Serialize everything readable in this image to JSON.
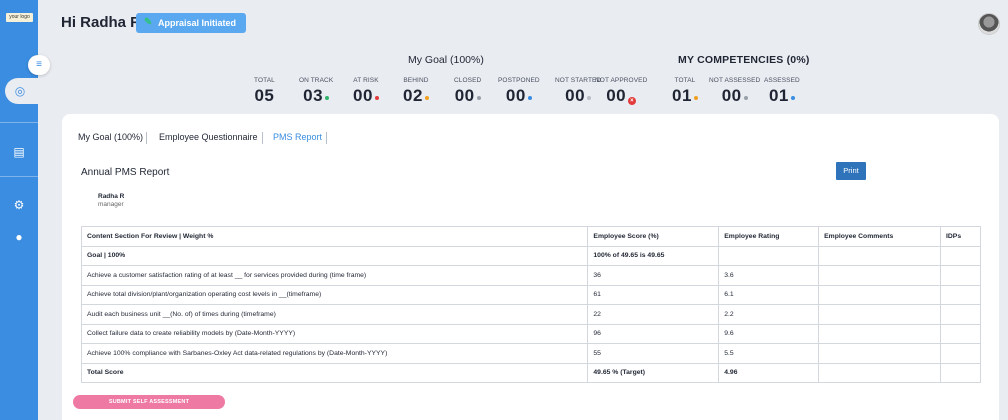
{
  "logo_text": "your logo",
  "header": {
    "greeting": "Hi Radha R",
    "appraisal_button": "Appraisal Initiated"
  },
  "goal_summary": {
    "title": "My Goal (100%)",
    "stats": [
      {
        "label": "TOTAL",
        "value": "05",
        "dot_color": ""
      },
      {
        "label": "ON TRACK",
        "value": "03",
        "dot_color": "#2fb36a"
      },
      {
        "label": "AT RISK",
        "value": "00",
        "dot_color": "#e23b3b"
      },
      {
        "label": "BEHIND",
        "value": "02",
        "dot_color": "#f0a020"
      },
      {
        "label": "CLOSED",
        "value": "00",
        "dot_color": "#9aa0aa"
      },
      {
        "label": "POSTPONED",
        "value": "00",
        "dot_color": "#3a8de0"
      },
      {
        "label": "NOT STARTED",
        "value": "00",
        "dot_color": "#b9bec7"
      },
      {
        "label": "NOT APPROVED",
        "value": "00",
        "dot_color": "#e23b3b"
      }
    ]
  },
  "competency_summary": {
    "title": "MY COMPETENCIES (0%)",
    "stats": [
      {
        "label": "TOTAL",
        "value": "01",
        "dot_color": "#f0a020"
      },
      {
        "label": "NOT ASSESSED",
        "value": "00",
        "dot_color": "#9aa0aa"
      },
      {
        "label": "ASSESSED",
        "value": "01",
        "dot_color": "#3a8de0"
      }
    ]
  },
  "tabs": [
    "My Goal (100%)",
    "Employee Questionnaire",
    "PMS Report"
  ],
  "active_tab": "PMS Report",
  "report": {
    "title": "Annual PMS Report",
    "print_label": "Print",
    "employee_name": "Radha R",
    "employee_role": "manager",
    "columns": [
      "Content Section For Review | Weight %",
      "Employee Score (%)",
      "Employee Rating",
      "Employee Comments",
      "IDPs"
    ],
    "rows": [
      [
        "Goal | 100%",
        "100% of 49.65 is 49.65",
        "",
        "",
        ""
      ],
      [
        "Achieve a customer satisfaction rating of at least __ for services provided during (time frame)",
        "36",
        "3.6",
        "",
        ""
      ],
      [
        "Achieve total division/plant/organization operating cost levels in __(timeframe)",
        "61",
        "6.1",
        "",
        ""
      ],
      [
        "Audit each business unit __(No. of) of times during (timeframe)",
        "22",
        "2.2",
        "",
        ""
      ],
      [
        "Collect failure data to create reliability models by (Date-Month-YYYY)",
        "96",
        "9.6",
        "",
        ""
      ],
      [
        "Achieve 100% compliance with Sarbanes-Oxley Act data-related regulations by (Date-Month-YYYY)",
        "55",
        "5.5",
        "",
        ""
      ],
      [
        "Total Score",
        "49.65 % (Target)",
        "4.96",
        "",
        ""
      ]
    ]
  },
  "submit_label": "SUBMIT SELF ASSESSMENT"
}
